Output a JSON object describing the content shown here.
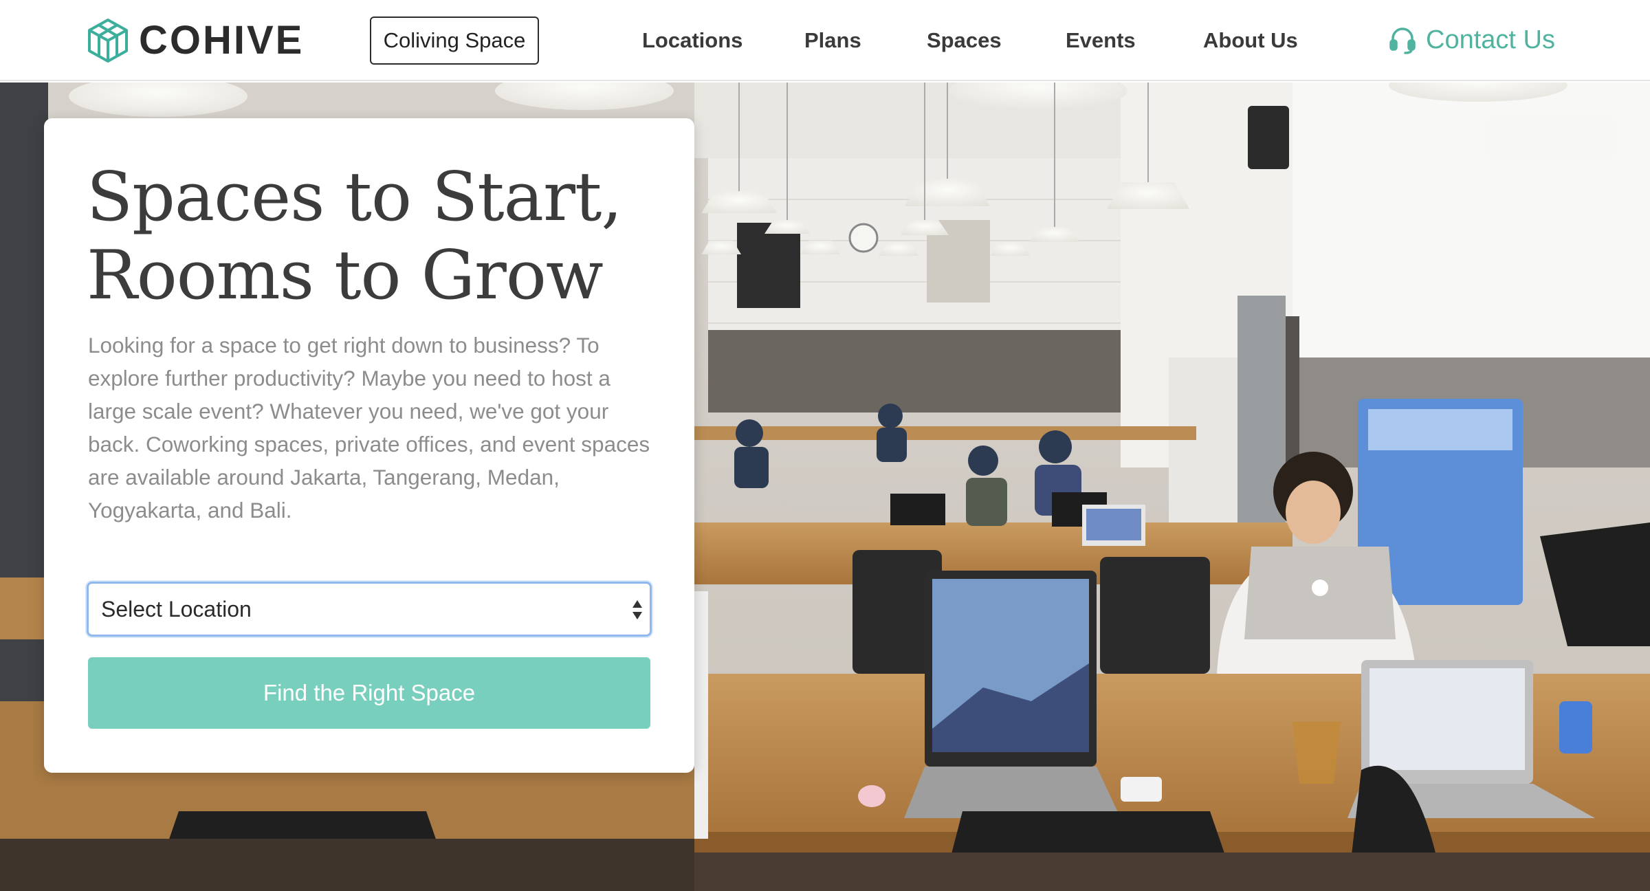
{
  "brand": {
    "name": "COHIVE",
    "logo_icon": "cohive-logo-icon"
  },
  "nav": {
    "coliving_label": "Coliving Space",
    "links": [
      "Locations",
      "Plans",
      "Spaces",
      "Events",
      "About Us"
    ],
    "contact_label": "Contact Us",
    "contact_icon": "headset-icon"
  },
  "hero": {
    "headline_line1": "Spaces to Start,",
    "headline_line2": "Rooms to Grow",
    "intro": "Looking for a space to get right down to business? To explore further productivity? Maybe you need to host a large scale event? Whatever you need, we've got your back. Coworking spaces, private offices, and event spaces are available around Jakarta, Tangerang, Medan, Yogyakarta, and Bali.",
    "location_select": "Select Location",
    "cta_label": "Find the Right Space"
  },
  "colors": {
    "accent": "#4fb3a0",
    "cta": "#79cfbd",
    "text_dark": "#3c3c3c",
    "text_muted": "#8c8c8c",
    "focus": "#8fb8ef"
  }
}
